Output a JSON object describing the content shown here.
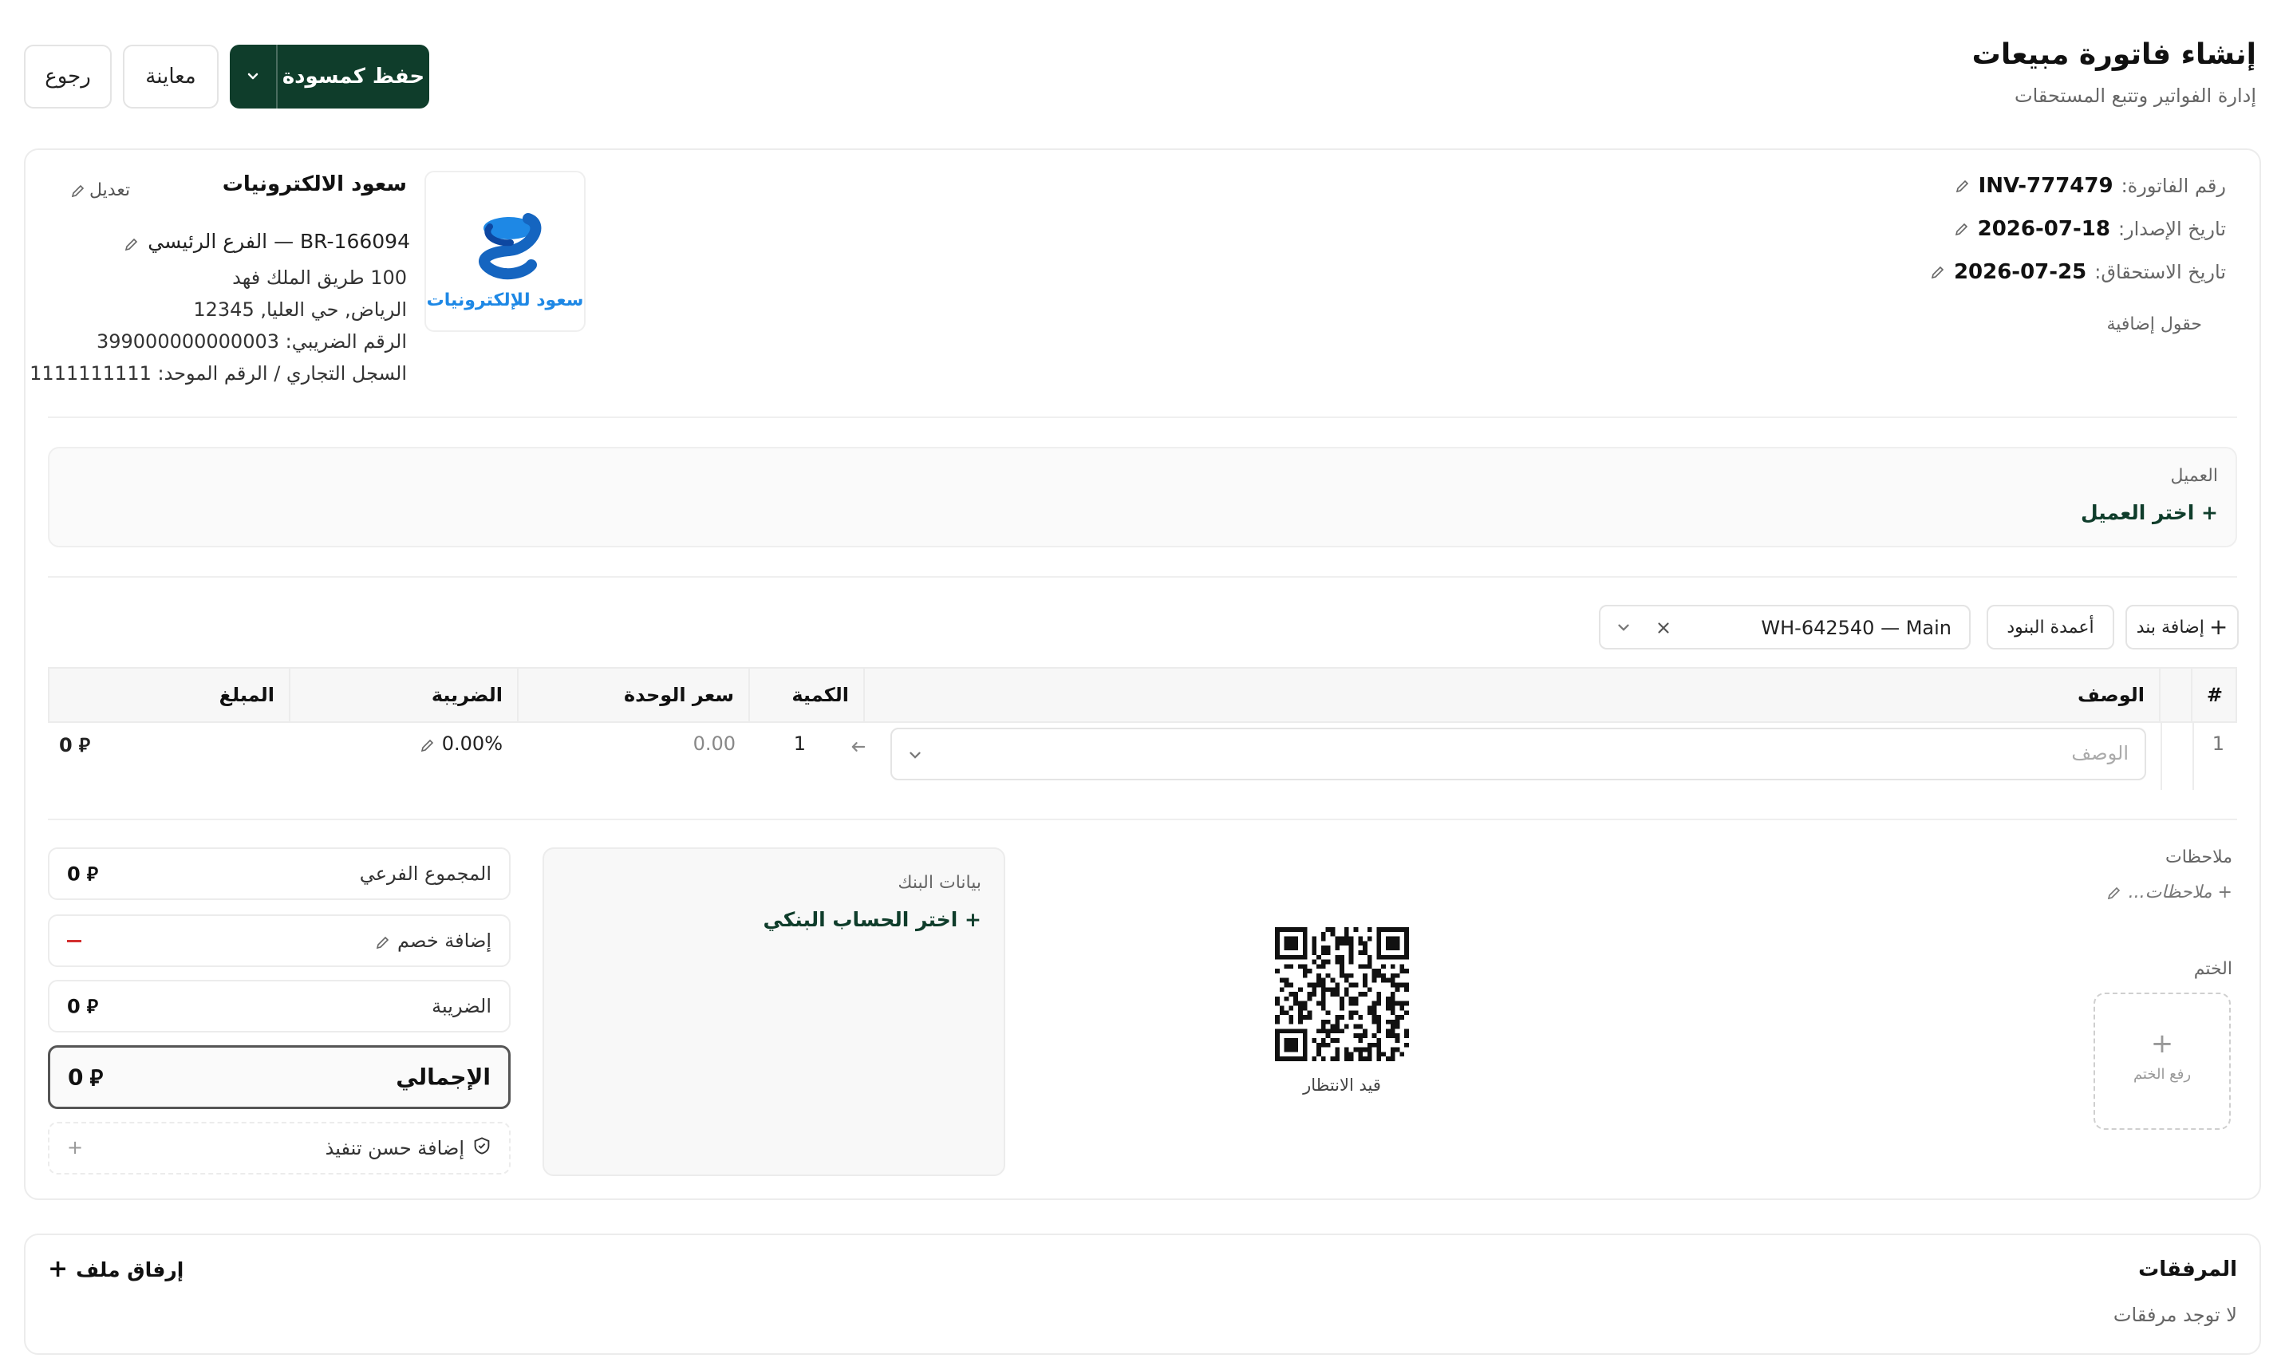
{
  "header": {
    "title": "إنشاء فاتورة مبيعات",
    "subtitle": "إدارة الفواتير وتتبع المستحقات",
    "save_draft_label": "حفظ كمسودة",
    "preview_label": "معاينة",
    "back_label": "رجوع"
  },
  "colors": {
    "primary": "#0f3d2b",
    "danger": "#d32f2f",
    "link": "#0f3d2b"
  },
  "invoice": {
    "number_label": "رقم الفاتورة:",
    "number": "INV-777479",
    "issue_label": "تاريخ الإصدار:",
    "issue_date": "2026-07-18",
    "due_label": "تاريخ الاستحقاق:",
    "due_date": "2026-07-25",
    "extra_fields_label": "حقول إضافية"
  },
  "company": {
    "name": "سعود الالكترونيات",
    "edit_label": "تعديل",
    "branch": "BR-166094 — الفرع الرئيسي",
    "address1": "100 طريق الملك فهد",
    "address2": "الرياض, حي العليا, 12345",
    "tax_number": "الرقم الضريبي: 399000000000003",
    "cr_number": "السجل التجاري / الرقم الموحد: 1111111111",
    "logo_text": "سعود للإلكترونيات"
  },
  "customer": {
    "label": "العميل",
    "choose_label": "+ اختر العميل"
  },
  "items_toolbar": {
    "add_item_label": "إضافة بند",
    "columns_label": "أعمدة البنود",
    "warehouse_value": "WH-642540 — Main"
  },
  "table": {
    "headers": {
      "index": "#",
      "description": "الوصف",
      "quantity": "الكمية",
      "unit_price": "سعر الوحدة",
      "tax": "الضريبة",
      "amount": "المبلغ"
    },
    "rows": [
      {
        "index": "1",
        "description_placeholder": "الوصف",
        "quantity": "1",
        "unit_price": "0.00",
        "tax": "0.00%",
        "amount": "0"
      }
    ]
  },
  "notes": {
    "label": "ملاحظات",
    "add_label": "+ ملاحظات..."
  },
  "stamp": {
    "label": "الختم",
    "upload_label": "رفع الختم"
  },
  "qr": {
    "status": "قيد الانتظار"
  },
  "bank": {
    "label": "بيانات البنك",
    "choose_label": "+ اختر الحساب البنكي"
  },
  "summary": {
    "subtotal_label": "المجموع الفرعي",
    "subtotal": "0",
    "discount_label": "إضافة خصم",
    "tax_label": "الضريبة",
    "tax": "0",
    "total_label": "الإجمالي",
    "total": "0",
    "performance_label": "إضافة حسن تنفيذ"
  },
  "attachments": {
    "title": "المرفقات",
    "empty": "لا توجد مرفقات",
    "attach_label": "إرفاق ملف"
  }
}
